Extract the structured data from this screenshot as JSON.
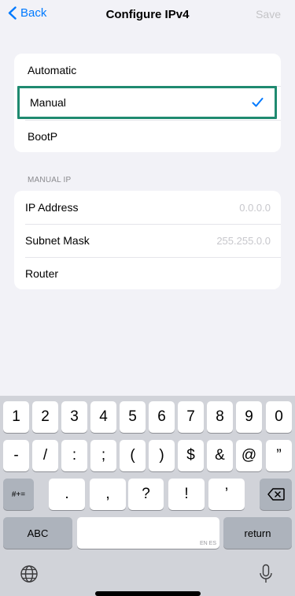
{
  "nav": {
    "back_label": "Back",
    "title": "Configure IPv4",
    "save_label": "Save"
  },
  "method": {
    "options": [
      "Automatic",
      "Manual",
      "BootP"
    ],
    "selected": "Manual"
  },
  "manual_ip": {
    "header": "MANUAL IP",
    "fields": [
      {
        "label": "IP Address",
        "placeholder": "0.0.0.0"
      },
      {
        "label": "Subnet Mask",
        "placeholder": "255.255.0.0"
      },
      {
        "label": "Router",
        "placeholder": ""
      }
    ]
  },
  "keyboard": {
    "row1": [
      "1",
      "2",
      "3",
      "4",
      "5",
      "6",
      "7",
      "8",
      "9",
      "0"
    ],
    "row2": [
      "-",
      "/",
      ":",
      ";",
      "(",
      ")",
      "$",
      "&",
      "@",
      "”"
    ],
    "row3_left": "#+=",
    "row3": [
      ".",
      ",",
      "?",
      "!",
      "’"
    ],
    "abc_label": "ABC",
    "space_hint": "EN ES",
    "return_label": "return",
    "icons": [
      "backspace-icon",
      "globe-icon",
      "mic-icon"
    ]
  },
  "colors": {
    "accent": "#007aff",
    "highlight_border": "#1f8a70",
    "placeholder": "#c7c7cc",
    "background": "#f2f2f7"
  }
}
